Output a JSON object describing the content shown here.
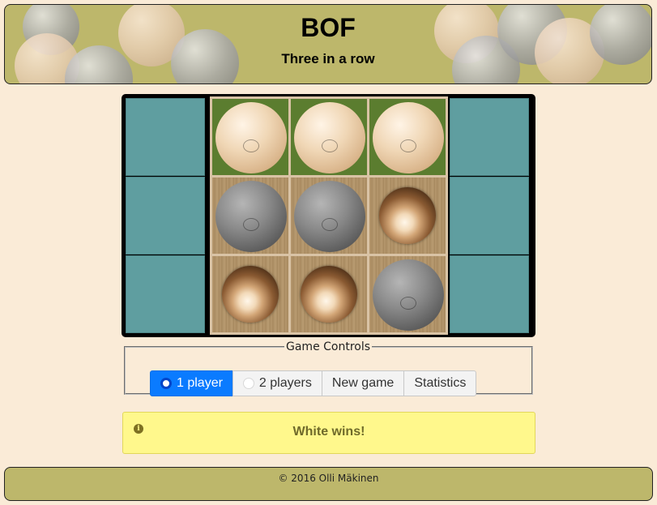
{
  "header": {
    "title": "BOF",
    "subtitle": "Three in a row"
  },
  "board": {
    "cells": [
      {
        "content": "white",
        "background": "green"
      },
      {
        "content": "white",
        "background": "green"
      },
      {
        "content": "white",
        "background": "green"
      },
      {
        "content": "black",
        "background": "wood"
      },
      {
        "content": "black",
        "background": "wood"
      },
      {
        "content": "empty",
        "background": "wood"
      },
      {
        "content": "empty",
        "background": "wood"
      },
      {
        "content": "empty",
        "background": "wood"
      },
      {
        "content": "black",
        "background": "wood"
      }
    ],
    "rack_color": "#5f9ea0",
    "win_color": "#5b7d2f"
  },
  "controls": {
    "legend": "Game Controls",
    "one_player": "1 player",
    "two_players": "2 players",
    "new_game": "New game",
    "statistics": "Statistics",
    "selected_mode": "1 player",
    "accent": "#0a7bff"
  },
  "message": {
    "icon": "info-icon",
    "text": "White wins!"
  },
  "footer": {
    "text": "© 2016 Olli Mäkinen"
  }
}
